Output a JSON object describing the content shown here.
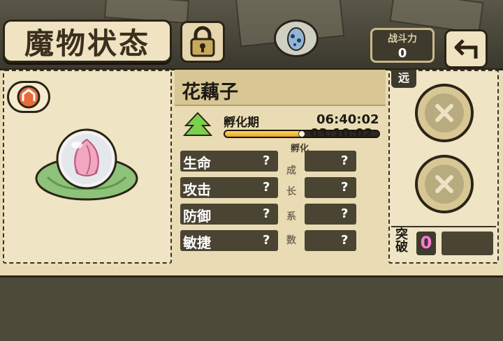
{
  "header": {
    "title": "魔物状态",
    "power_label": "战斗力",
    "power_value": "0"
  },
  "monster": {
    "name": "花藕子",
    "stage_label": "孵化期",
    "time_total": "06:40:02",
    "time_remaining": "03:10:02",
    "hatch_label": "孵化",
    "progress": 0.5
  },
  "stats": [
    {
      "name": "生命",
      "value": "?"
    },
    {
      "name": "攻击",
      "value": "?"
    },
    {
      "name": "防御",
      "value": "?"
    },
    {
      "name": "敏捷",
      "value": "?"
    }
  ],
  "growth": {
    "chars": [
      "成",
      "长",
      "系",
      "数"
    ],
    "values": [
      "?",
      "?",
      "?",
      "?"
    ]
  },
  "side": {
    "range_label": "远",
    "break_label": "突破",
    "break_value": "0"
  },
  "colors": {
    "panel": "#e9dbb3",
    "dark_row": "#4a4433",
    "break_value": "#ff7ad9"
  }
}
